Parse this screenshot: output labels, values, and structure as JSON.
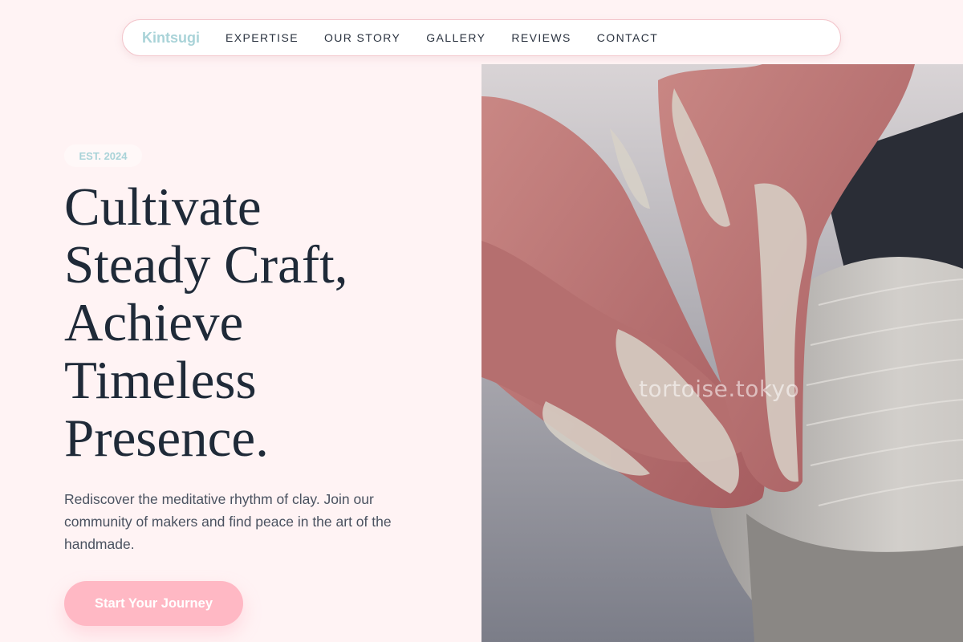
{
  "nav": {
    "brand": "Kintsugi",
    "links": [
      "EXPERTISE",
      "OUR STORY",
      "GALLERY",
      "REVIEWS",
      "CONTACT"
    ]
  },
  "hero": {
    "badge": "EST. 2024",
    "headline_lines": [
      "Cultivate",
      "Steady Craft,",
      "Achieve",
      "Timeless",
      "Presence."
    ],
    "description": "Rediscover the meditative rhythm of clay. Join our community of makers and find peace in the art of the handmade.",
    "cta_label": "Start Your Journey",
    "image_watermark": "tortoise.tokyo"
  },
  "colors": {
    "background": "#fff3f4",
    "accent_pink": "#ffb8c4",
    "accent_teal": "#a9d3d8",
    "text_dark": "#1f2a38"
  }
}
